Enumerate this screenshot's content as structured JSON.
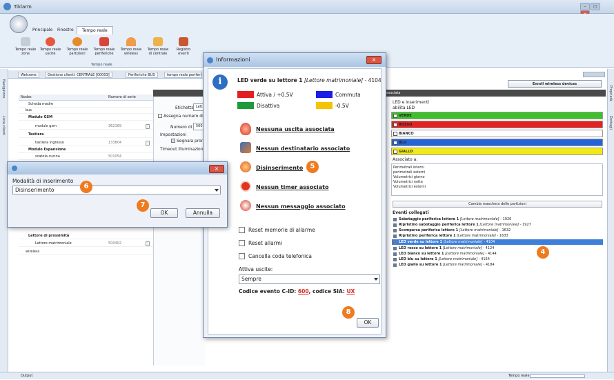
{
  "app": {
    "title": "Tiklarm"
  },
  "ribbon": {
    "tabs": [
      "Principale",
      "Finestre",
      "Tempo reale"
    ],
    "buttons": [
      "Tempo reale\nzone",
      "Tempo reale\nuscite",
      "Tempo reale\npartizioni",
      "Tempo reale\nperiferiche",
      "Tempo reale\nwireless",
      "Tempo reale\ndi centrale",
      "Registro\neventi"
    ],
    "group_label": "Tempo reale"
  },
  "doc_tabs": [
    "Welcome",
    "Gestione clienti: CENTRALE [00003]",
    "Periferiche BUS",
    "tempo reale periferi"
  ],
  "left_strip": [
    "Navigatore",
    "Lista clienti"
  ],
  "tree": {
    "headers": [
      "Nodes",
      "Numero di serie"
    ],
    "rows": [
      {
        "label": "Scheda madre",
        "serial": ""
      },
      {
        "label": "bus",
        "serial": ""
      },
      {
        "label": "Modulo GSM",
        "serial": ""
      },
      {
        "label": "modulo gsm",
        "serial": "362169"
      },
      {
        "label": "Tastiera",
        "serial": ""
      },
      {
        "label": "tastiera ingresso",
        "serial": "133804"
      },
      {
        "label": "Modulo Espansione",
        "serial": ""
      },
      {
        "label": "scatola cucina",
        "serial": "501054"
      },
      {
        "label": "Lettore di prossimità",
        "serial": ""
      },
      {
        "label": "Lettore matrimoniale",
        "serial": "500402"
      },
      {
        "label": "wireless",
        "serial": ""
      }
    ]
  },
  "mid": {
    "etichetta": "Etichetta",
    "etichetta_val": "Lett",
    "assegna": "Assegna numero di se",
    "numero_serie": "Numero di serie",
    "numero_serie_val": "500",
    "impostazioni": "Impostazioni",
    "segnala": "Segnala pronto all",
    "timeout": "Timeout illuminazione LE"
  },
  "right": {
    "enroll": "Enroll wireless devices",
    "header": "ssociata",
    "led_inserimenti": "LED e inserimenti",
    "abilita_led": "abilita LED",
    "colors": [
      {
        "label": "VERDE",
        "color": "#3fbf2c",
        "checked": true
      },
      {
        "label": "ROSSO",
        "color": "#e32222",
        "checked": true
      },
      {
        "label": "BIANCO",
        "color": "#ffffff",
        "checked": false
      },
      {
        "label": "BLU",
        "color": "#2563d9",
        "checked": true
      },
      {
        "label": "GIALLO",
        "color": "#f0ea1a",
        "checked": true
      }
    ],
    "associato": "Associato a:",
    "list": [
      "Perimetrali interni",
      "perimetrali esterni",
      "Volumetrici giorno",
      "Volumetrici notte",
      "Volumetrici esterni"
    ],
    "cambia": "Cambia maschera delle partizioni",
    "eventi_title": "Eventi collegati",
    "events": [
      {
        "name": "Sabotaggio periferica lettore 1",
        "dev": "[Lettore matrimoniale]",
        "code": " - 1926",
        "selected": false
      },
      {
        "name": "Ripristino sabotaggio periferica lettore 1",
        "dev": "[Lettore matrimoniale]",
        "code": " - 1927",
        "selected": false
      },
      {
        "name": "Scomparsa periferica lettore 1",
        "dev": "[Lettore matrimoniale]",
        "code": " - 1632",
        "selected": false
      },
      {
        "name": "Ripristino periferica lettore 1",
        "dev": "[Lettore matrimoniale]",
        "code": " - 1633",
        "selected": false
      },
      {
        "name": "LED verde su lettore 1",
        "dev": "[Lettore matrimoniale]",
        "code": " - 4104",
        "selected": true
      },
      {
        "name": "LED rosso su lettore 1",
        "dev": "[Lettore matrimoniale]",
        "code": " - 4124",
        "selected": false
      },
      {
        "name": "LED bianco su lettore 1",
        "dev": "[Lettore matrimoniale]",
        "code": " - 4144",
        "selected": false
      },
      {
        "name": "LED blu su lettore 1",
        "dev": "[Lettore matrimoniale]",
        "code": " - 4164",
        "selected": false
      },
      {
        "name": "LED giallo su lettore 1",
        "dev": "[Lettore matrimoniale]",
        "code": " - 4184",
        "selected": false
      }
    ]
  },
  "right_strip": [
    "Proprietà",
    "Dettagli"
  ],
  "status": {
    "output": "Output",
    "tempo": "Tempo reale"
  },
  "info_dialog": {
    "title": "Informazioni",
    "heading": "LED verde su lettore 1",
    "heading_dev": "[Lettore matrimoniale]",
    "heading_code": " - 4104",
    "legend": [
      {
        "label": "Attiva / +0.5V",
        "color": "#e32020"
      },
      {
        "label": "Commuta",
        "color": "#1b1ee6"
      },
      {
        "label": "Disattiva",
        "color": "#1f9a3a"
      },
      {
        "label": "-0.5V",
        "color": "#f4c400"
      }
    ],
    "items": [
      "Nessuna uscita associata",
      "Nessun destinatario associato",
      "Disinserimento",
      "Nessun timer associato",
      "Nessun messaggio associato"
    ],
    "checkboxes": [
      "Reset memorie di allarme",
      "Reset allarmi",
      "Cancella coda telefonica"
    ],
    "attiva_uscite": "Attiva uscite:",
    "sempre": "Sempre",
    "codice_label": "Codice evento C-ID: ",
    "cid": "600",
    "sia_label": ", codice SIA: ",
    "sia": "UX",
    "ok": "OK"
  },
  "mode_dialog": {
    "label": "Modalità di inserimento",
    "value": "Disinserimento",
    "ok": "OK",
    "annulla": "Annulla"
  },
  "badges": [
    "4",
    "5",
    "6",
    "7",
    "8"
  ]
}
